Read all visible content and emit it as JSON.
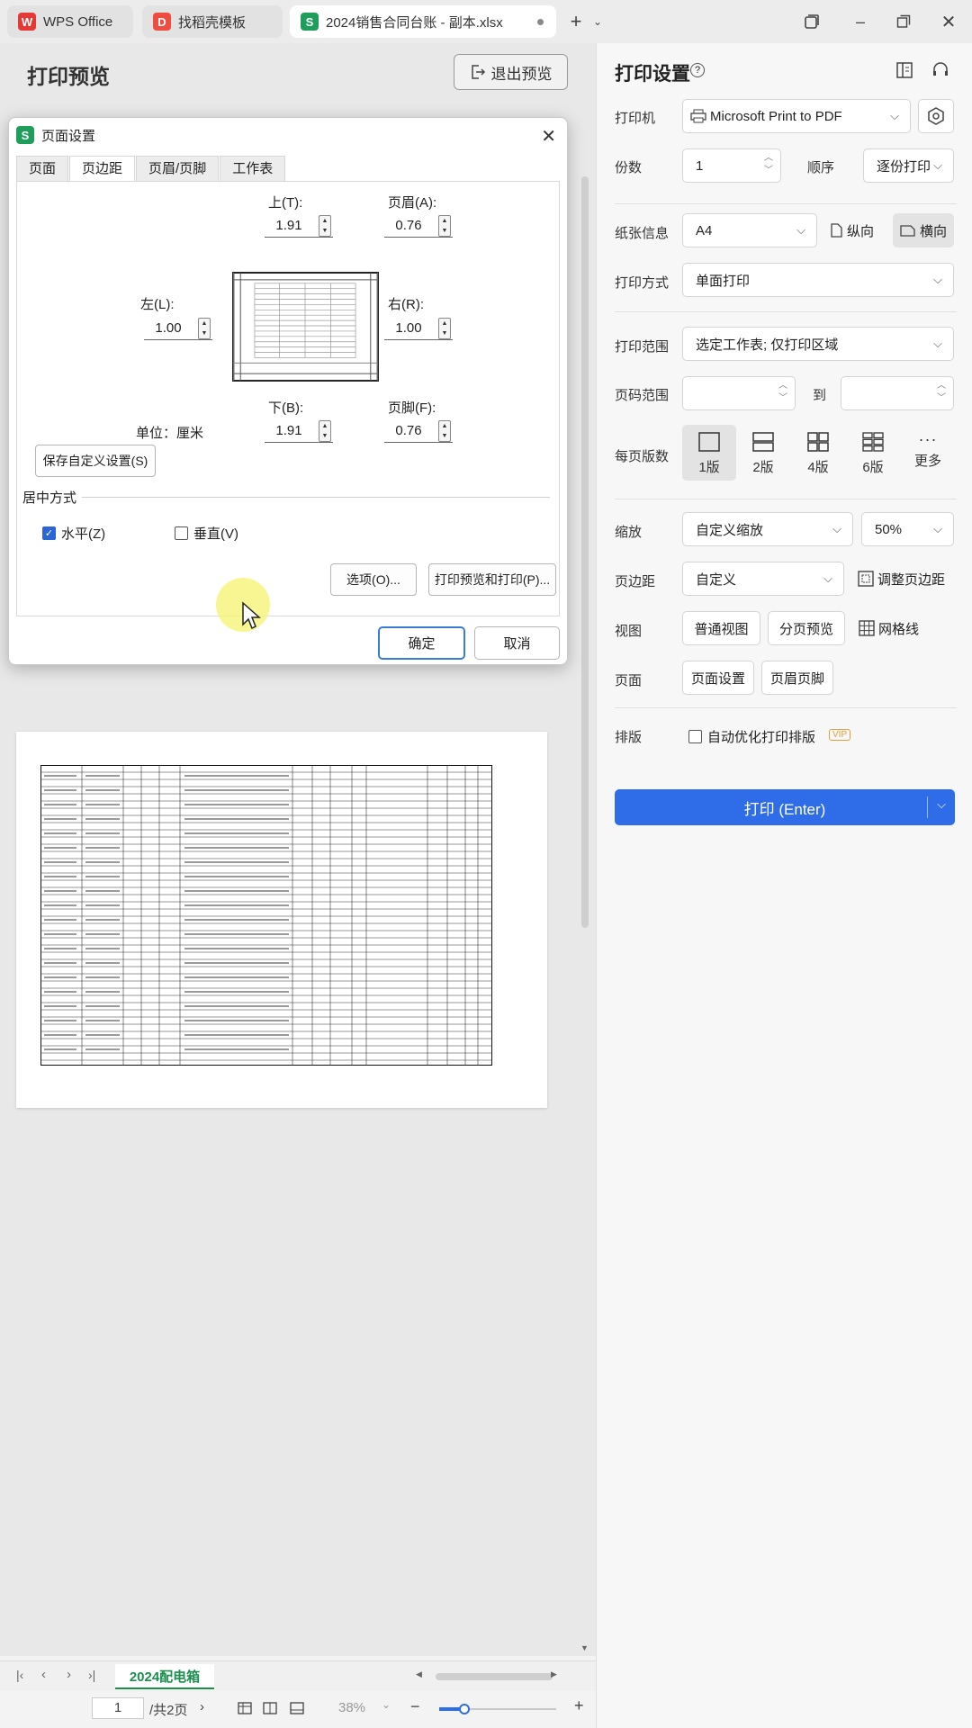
{
  "tabs": [
    {
      "label": "WPS Office"
    },
    {
      "label": "找稻壳模板"
    },
    {
      "label": "2024销售合同台账 - 副本.xlsx"
    }
  ],
  "preview": {
    "title": "打印预览",
    "exit_label": "退出预览"
  },
  "dialog": {
    "title": "页面设置",
    "tabs": [
      "页面",
      "页边距",
      "页眉/页脚",
      "工作表"
    ],
    "active_tab": "页边距",
    "top_label": "上(T):",
    "top_value": "1.91",
    "header_label": "页眉(A):",
    "header_value": "0.76",
    "left_label": "左(L):",
    "left_value": "1.00",
    "right_label": "右(R):",
    "right_value": "1.00",
    "bottom_label": "下(B):",
    "bottom_value": "1.91",
    "footer_label": "页脚(F):",
    "footer_value": "0.76",
    "unit_label": "单位：厘米",
    "save_custom_label": "保存自定义设置(S)",
    "center_group_label": "居中方式",
    "horizontal_label": "水平(Z)",
    "horizontal_checked": true,
    "vertical_label": "垂直(V)",
    "vertical_checked": false,
    "options_label": "选项(O)...",
    "preview_print_label": "打印预览和打印(P)...",
    "ok_label": "确定",
    "cancel_label": "取消"
  },
  "status": {
    "sheet_tab": "2024配电箱",
    "page_current": "1",
    "page_total": "/共2页",
    "zoom": "38%"
  },
  "settings": {
    "title": "打印设置",
    "printer_label": "打印机",
    "printer_value": "Microsoft Print to PDF",
    "copies_label": "份数",
    "copies_value": "1",
    "order_label": "顺序",
    "order_value": "逐份打印",
    "paper_label": "纸张信息",
    "paper_value": "A4",
    "portrait_label": "纵向",
    "landscape_label": "横向",
    "mode_label": "打印方式",
    "mode_value": "单面打印",
    "range_label": "打印范围",
    "range_value": "选定工作表; 仅打印区域",
    "pages_label": "页码范围",
    "pages_to": "到",
    "per_page_label": "每页版数",
    "layouts": [
      "1版",
      "2版",
      "4版",
      "6版",
      "更多"
    ],
    "scale_label": "缩放",
    "scale_value": "自定义缩放",
    "scale_percent": "50%",
    "margin_label": "页边距",
    "margin_value": "自定义",
    "adjust_margin_label": "调整页边距",
    "view_label": "视图",
    "normal_view": "普通视图",
    "page_break_view": "分页预览",
    "gridlines_label": "网格线",
    "page_label": "页面",
    "page_setup_btn": "页面设置",
    "header_footer_btn": "页眉页脚",
    "arrange_label": "排版",
    "auto_optimize_label": "自动优化打印排版",
    "vip_label": "VIP",
    "print_label": "打印 (Enter)"
  },
  "colors": {
    "accent": "#2f6de8",
    "sheet_green": "#1c8f4d",
    "wps_red": "#e53935"
  }
}
